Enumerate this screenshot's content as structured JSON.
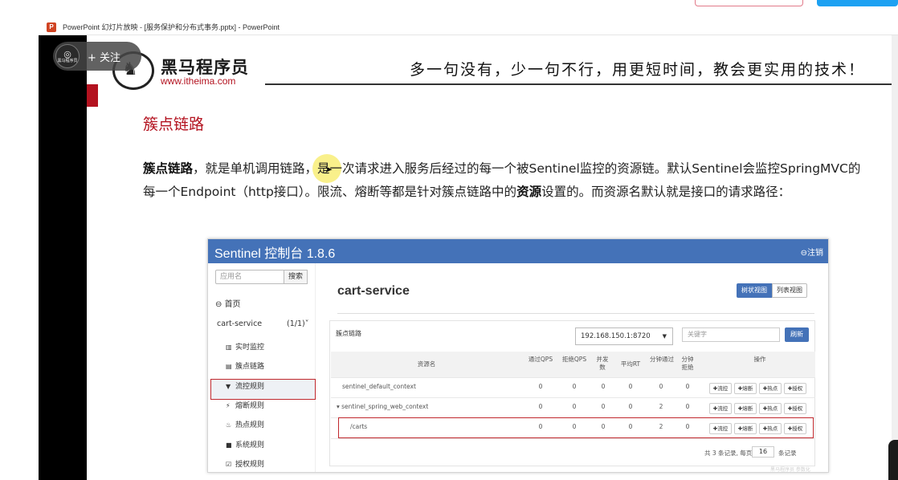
{
  "window": {
    "app_icon": "powerpoint-icon",
    "title": "PowerPoint 幻灯片放映 - [服务保护和分布式事务.pptx] - PowerPoint"
  },
  "overlay": {
    "avatar_char": "◎",
    "avatar_text": "黑马程序员",
    "follow_label": "+ 关注"
  },
  "slide_header": {
    "logo_name": "黑马程序员",
    "logo_url": "www.itheima.com",
    "slogan": "多一句没有，少一句不行，用更短时间，教会更实用的技术！"
  },
  "slide": {
    "heading": "簇点链路",
    "para_bold_1": "簇点链路",
    "para_text_1": "，就是单机调用链路，是一次请求进入服务后经过的每一个被Sentinel监控的资源链。默认Sentinel会监控SpringMVC的每一个Endpoint（http接口）。限流、熔断等都是针对簇点链路中的",
    "para_bold_2": "资源",
    "para_text_2": "设置的。而资源名默认就是接口的请求路径："
  },
  "console": {
    "title": "Sentinel 控制台 1.8.6",
    "logout": "⊖注销",
    "search_placeholder": "应用名",
    "search_button": "搜索",
    "home": "首页",
    "app_name": "cart-service",
    "app_count": "(1/1)˅",
    "menu": [
      {
        "icon": "bar-chart-icon",
        "glyph": "▥",
        "label": "实时监控"
      },
      {
        "icon": "list-icon",
        "glyph": "▤",
        "label": "簇点链路"
      },
      {
        "icon": "filter-icon",
        "glyph": "▼",
        "label": "流控规则"
      },
      {
        "icon": "flash-icon",
        "glyph": "⚡",
        "label": "熔断规则"
      },
      {
        "icon": "fire-icon",
        "glyph": "♨",
        "label": "热点规则"
      },
      {
        "icon": "lock-icon",
        "glyph": "■",
        "label": "系统规则"
      },
      {
        "icon": "check-icon",
        "glyph": "☑",
        "label": "授权规则"
      }
    ],
    "main_title": "cart-service",
    "view_tree": "树状视图",
    "view_list": "列表视图",
    "panel_label": "簇点链路",
    "ip_value": "192.168.150.1:8720",
    "keyword_placeholder": "关键字",
    "refresh": "刷新",
    "headers": [
      "资源名",
      "通过QPS",
      "拒绝QPS",
      "并发数",
      "平均RT",
      "分钟通过",
      "分钟拒绝",
      "操作"
    ],
    "rows": [
      {
        "name": "sentinel_default_context",
        "values": [
          "0",
          "0",
          "0",
          "0",
          "0",
          "0"
        ]
      },
      {
        "name": "▾ sentinel_spring_web_context",
        "values": [
          "0",
          "0",
          "0",
          "0",
          "2",
          "0"
        ]
      },
      {
        "name": "/carts",
        "values": [
          "0",
          "0",
          "0",
          "0",
          "2",
          "0"
        ]
      }
    ],
    "ops": [
      "✚流控",
      "✚熔断",
      "✚热点",
      "✚授权"
    ],
    "pager_text": "共 3 条记录, 每页",
    "page_size": "16",
    "pager_unit": "条记录",
    "watermark": "黑马程序员 参数化"
  }
}
